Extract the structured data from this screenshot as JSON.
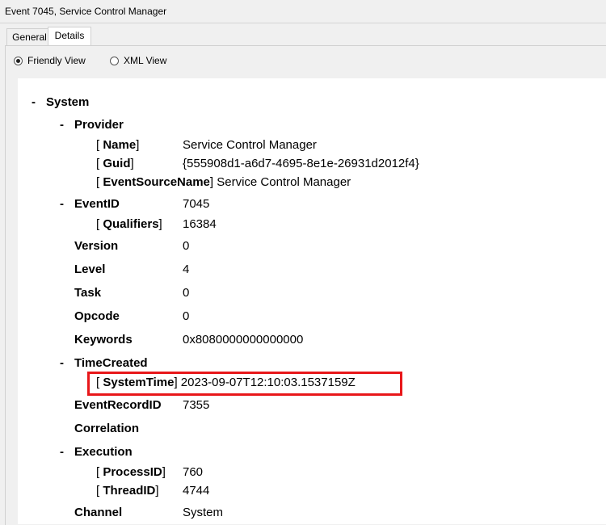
{
  "window": {
    "title": "Event 7045, Service Control Manager"
  },
  "tabs": [
    {
      "label": "General",
      "active": false
    },
    {
      "label": "Details",
      "active": true
    }
  ],
  "view_options": {
    "friendly": {
      "label": "Friendly View",
      "selected": true
    },
    "xml": {
      "label": "XML View",
      "selected": false
    }
  },
  "tree": {
    "collapse_symbol": "-",
    "system": {
      "label": "System"
    },
    "provider": {
      "label": "Provider",
      "name": {
        "key": "Name",
        "value": "Service Control Manager"
      },
      "guid": {
        "key": "Guid",
        "value": "{555908d1-a6d7-4695-8e1e-26931d2012f4}"
      },
      "event_source_name": {
        "key": "EventSourceName",
        "value": "Service Control Manager"
      }
    },
    "event_id": {
      "label": "EventID",
      "value": "7045",
      "qualifiers": {
        "key": "Qualifiers",
        "value": "16384"
      }
    },
    "version": {
      "label": "Version",
      "value": "0"
    },
    "level": {
      "label": "Level",
      "value": "4"
    },
    "task": {
      "label": "Task",
      "value": "0"
    },
    "opcode": {
      "label": "Opcode",
      "value": "0"
    },
    "keywords": {
      "label": "Keywords",
      "value": "0x8080000000000000"
    },
    "time_created": {
      "label": "TimeCreated",
      "system_time": {
        "key": "SystemTime",
        "value": "2023-09-07T12:10:03.1537159Z"
      }
    },
    "event_record_id": {
      "label": "EventRecordID",
      "value": "7355"
    },
    "correlation": {
      "label": "Correlation"
    },
    "execution": {
      "label": "Execution",
      "process_id": {
        "key": "ProcessID",
        "value": "760"
      },
      "thread_id": {
        "key": "ThreadID",
        "value": "4744"
      }
    },
    "channel": {
      "label": "Channel",
      "value": "System"
    }
  },
  "colors": {
    "highlight_box": "#e8171a"
  }
}
